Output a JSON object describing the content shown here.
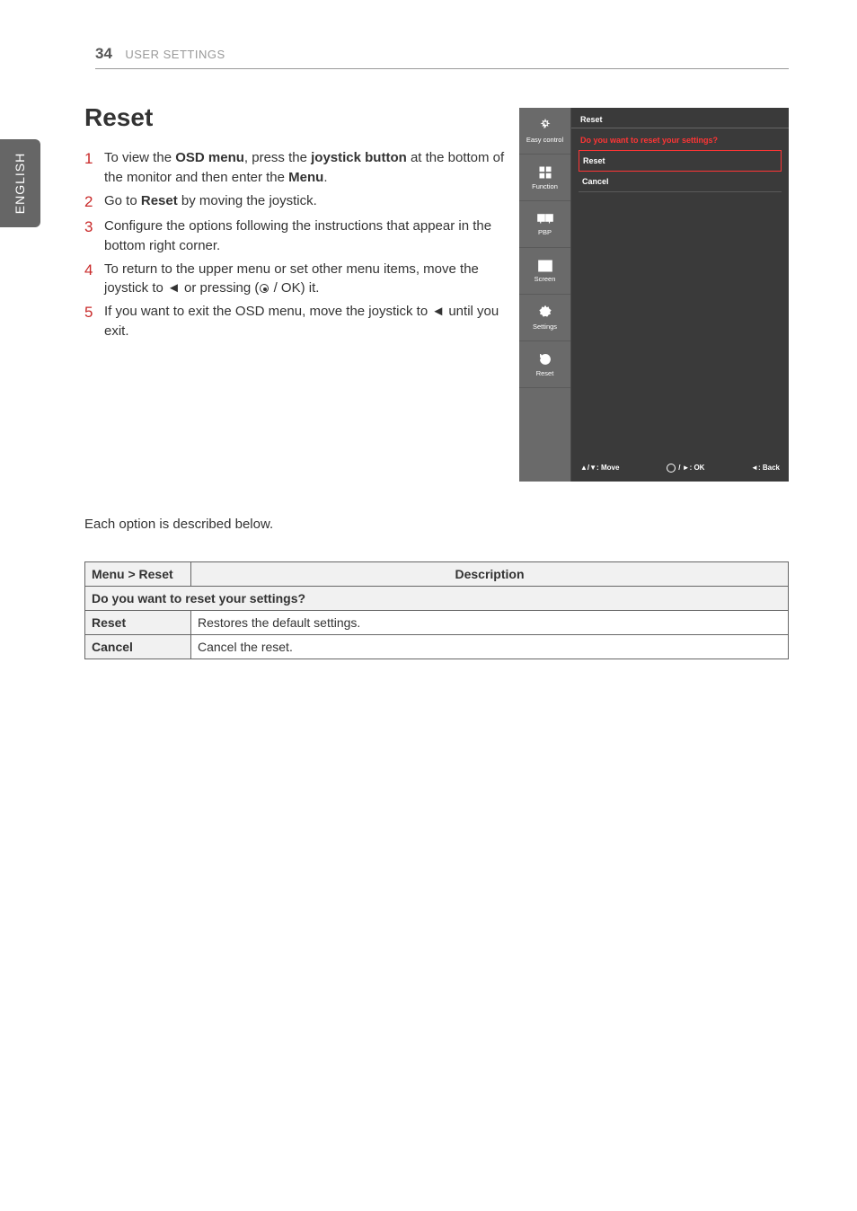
{
  "header": {
    "page": "34",
    "section": "USER SETTINGS"
  },
  "lang_tab": "ENGLISH",
  "title": "Reset",
  "steps": {
    "s1a": "To view the ",
    "s1b": "OSD menu",
    "s1c": ", press the ",
    "s1d": "joystick button",
    "s1e": " at the bottom of the monitor and then enter the ",
    "s1f": "Menu",
    "s1g": ".",
    "s2a": "Go to ",
    "s2b": "Reset",
    "s2c": " by moving the joystick.",
    "s3": "Configure the options following the instructions that appear in the bottom right corner.",
    "s4a": "To return to the upper menu or set other menu items, move the joystick to ◄ or pressing (",
    "s4b": " / OK) it.",
    "s5": "If you want to exit the OSD menu, move the joystick to ◄ until you exit."
  },
  "osd": {
    "side": [
      {
        "label": "Easy control"
      },
      {
        "label": "Function"
      },
      {
        "label": "PBP"
      },
      {
        "label": "Screen"
      },
      {
        "label": "Settings"
      },
      {
        "label": "Reset"
      }
    ],
    "title": "Reset",
    "question": "Do you want to reset your settings?",
    "opt1": "Reset",
    "opt2": "Cancel",
    "foot1": "▲/▼: Move",
    "foot2": " / ►: OK",
    "foot3": "◄: Back"
  },
  "below": "Each option is described below.",
  "table": {
    "h1": "Menu > Reset",
    "h2": "Description",
    "row1": "Do you want to reset your settings?",
    "r2c1": "Reset",
    "r2c2": "Restores the default settings.",
    "r3c1": "Cancel",
    "r3c2": "Cancel the reset."
  }
}
